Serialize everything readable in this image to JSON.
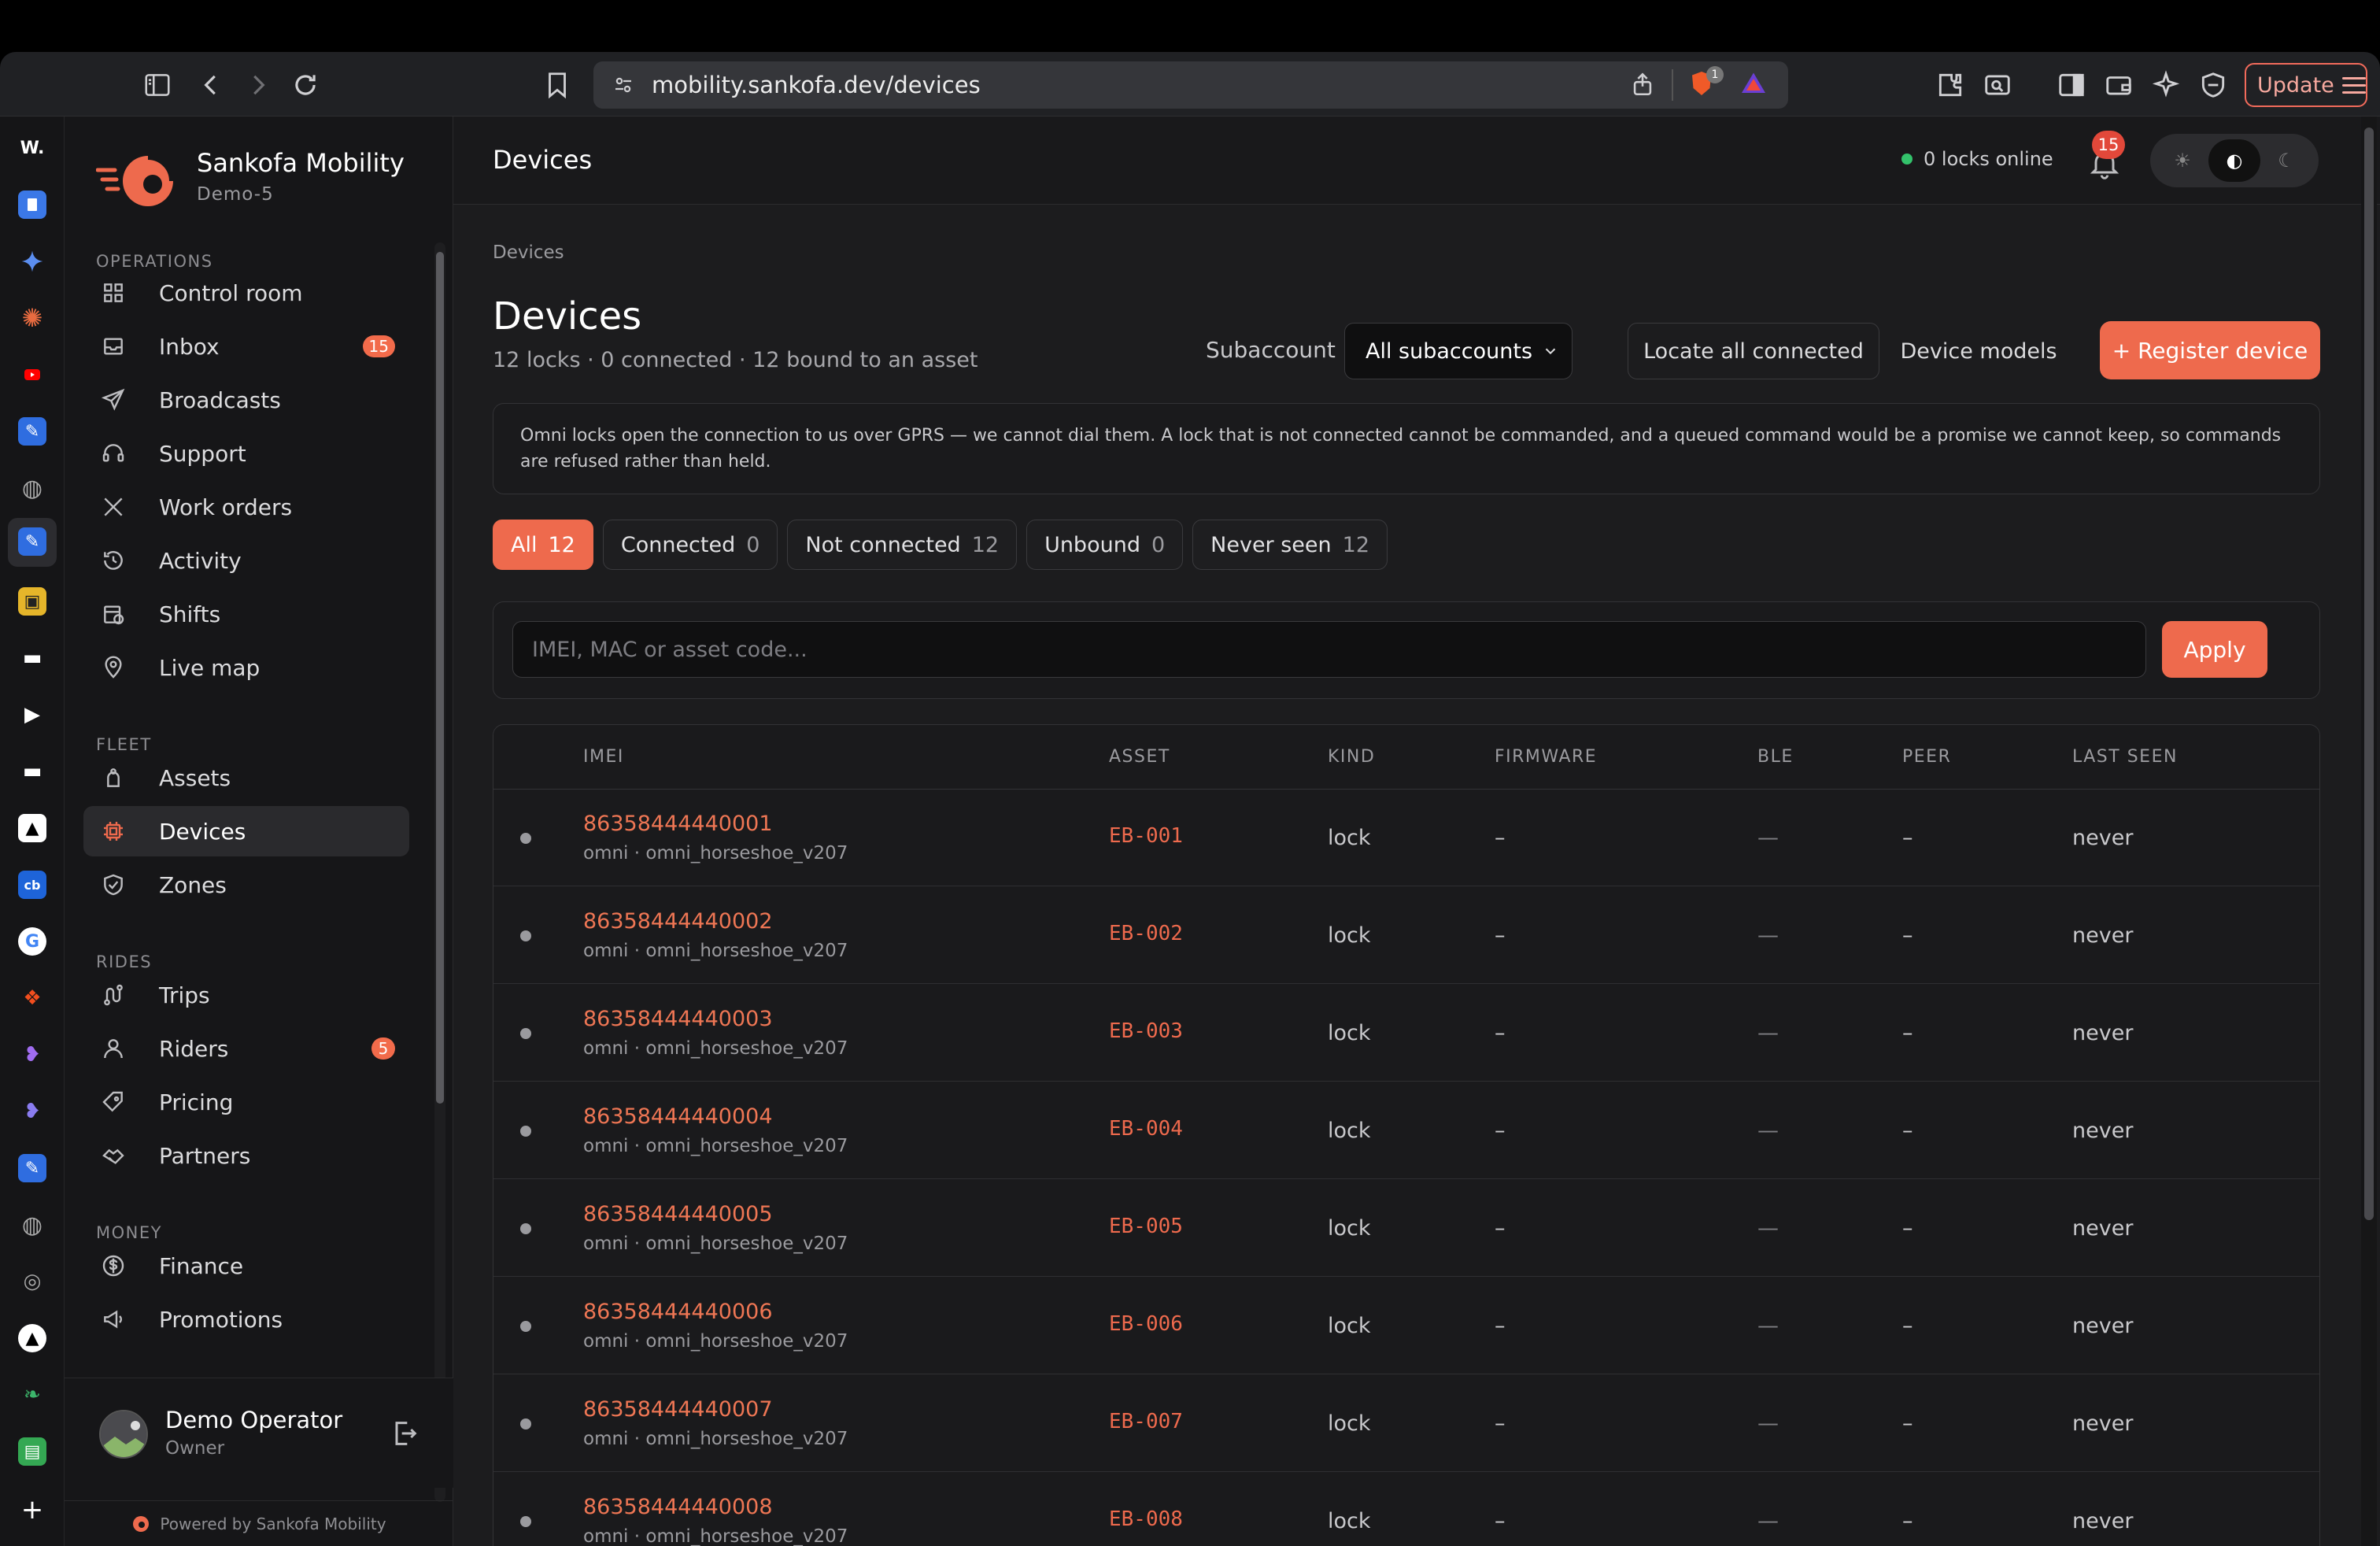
{
  "browser": {
    "url": "mobility.sankofa.dev/devices",
    "update_label": "Update",
    "shield_count": "1"
  },
  "sidebar": {
    "brand_name": "Sankofa Mobility",
    "brand_sub": "Demo-5",
    "sections": {
      "operations": "OPERATIONS",
      "fleet": "FLEET",
      "rides": "RIDES",
      "money": "MONEY"
    },
    "items": {
      "control_room": "Control room",
      "inbox": "Inbox",
      "inbox_badge": "15",
      "broadcasts": "Broadcasts",
      "support": "Support",
      "work_orders": "Work orders",
      "activity": "Activity",
      "shifts": "Shifts",
      "live_map": "Live map",
      "assets": "Assets",
      "devices": "Devices",
      "zones": "Zones",
      "trips": "Trips",
      "riders": "Riders",
      "riders_badge": "5",
      "pricing": "Pricing",
      "partners": "Partners",
      "finance": "Finance",
      "promotions": "Promotions"
    },
    "user": {
      "name": "Demo Operator",
      "role": "Owner"
    },
    "powered_by": "Powered by Sankofa Mobility"
  },
  "header": {
    "title": "Devices",
    "online_text": "0 locks online",
    "notif_count": "15"
  },
  "page": {
    "breadcrumb": "Devices",
    "title": "Devices",
    "subtitle": "12 locks · 0 connected · 12 bound to an asset",
    "subaccount_label": "Subaccount",
    "subaccount_value": "All subaccounts",
    "locate_label": "Locate all connected",
    "models_label": "Device models",
    "register_label": "+ Register device",
    "notice": "Omni locks open the connection to us over GPRS — we cannot dial them. A lock that is not connected cannot be commanded, and a queued command would be a promise we cannot keep, so commands are refused rather than held.",
    "filters": [
      {
        "label": "All",
        "count": "12"
      },
      {
        "label": "Connected",
        "count": "0"
      },
      {
        "label": "Not connected",
        "count": "12"
      },
      {
        "label": "Unbound",
        "count": "0"
      },
      {
        "label": "Never seen",
        "count": "12"
      }
    ],
    "search_placeholder": "IMEI, MAC or asset code...",
    "apply_label": "Apply"
  },
  "table": {
    "headers": {
      "imei": "IMEI",
      "asset": "ASSET",
      "kind": "KIND",
      "firmware": "FIRMWARE",
      "ble": "BLE",
      "peer": "PEER",
      "last_seen": "LAST SEEN"
    },
    "rows": [
      {
        "imei": "86358444440001",
        "sub": "omni · omni_horseshoe_v207",
        "asset": "EB-001",
        "kind": "lock",
        "firmware": "–",
        "ble": "—",
        "peer": "–",
        "last_seen": "never"
      },
      {
        "imei": "86358444440002",
        "sub": "omni · omni_horseshoe_v207",
        "asset": "EB-002",
        "kind": "lock",
        "firmware": "–",
        "ble": "—",
        "peer": "–",
        "last_seen": "never"
      },
      {
        "imei": "86358444440003",
        "sub": "omni · omni_horseshoe_v207",
        "asset": "EB-003",
        "kind": "lock",
        "firmware": "–",
        "ble": "—",
        "peer": "–",
        "last_seen": "never"
      },
      {
        "imei": "86358444440004",
        "sub": "omni · omni_horseshoe_v207",
        "asset": "EB-004",
        "kind": "lock",
        "firmware": "–",
        "ble": "—",
        "peer": "–",
        "last_seen": "never"
      },
      {
        "imei": "86358444440005",
        "sub": "omni · omni_horseshoe_v207",
        "asset": "EB-005",
        "kind": "lock",
        "firmware": "–",
        "ble": "—",
        "peer": "–",
        "last_seen": "never"
      },
      {
        "imei": "86358444440006",
        "sub": "omni · omni_horseshoe_v207",
        "asset": "EB-006",
        "kind": "lock",
        "firmware": "–",
        "ble": "—",
        "peer": "–",
        "last_seen": "never"
      },
      {
        "imei": "86358444440007",
        "sub": "omni · omni_horseshoe_v207",
        "asset": "EB-007",
        "kind": "lock",
        "firmware": "–",
        "ble": "—",
        "peer": "–",
        "last_seen": "never"
      },
      {
        "imei": "86358444440008",
        "sub": "omni · omni_horseshoe_v207",
        "asset": "EB-008",
        "kind": "lock",
        "firmware": "–",
        "ble": "—",
        "peer": "–",
        "last_seen": "never"
      }
    ]
  },
  "colors": {
    "accent": "#ee6a4d",
    "online": "#33c26b",
    "badge": "#e2483a"
  }
}
